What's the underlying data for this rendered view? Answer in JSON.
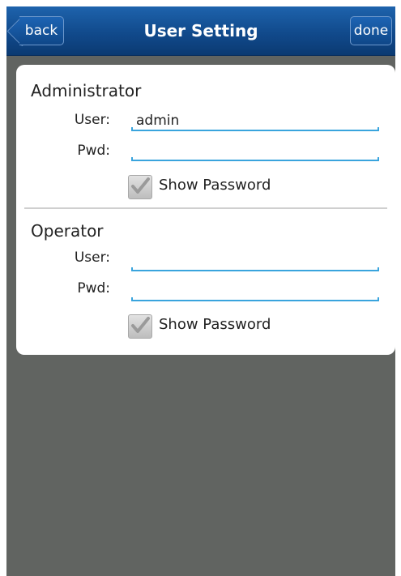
{
  "header": {
    "title": "User Setting",
    "back_label": "back",
    "done_label": "done"
  },
  "administrator": {
    "title": "Administrator",
    "user_label": "User:",
    "user_value": "admin",
    "pwd_label": "Pwd:",
    "pwd_value": "",
    "show_password_label": "Show Password",
    "show_password_checked": true
  },
  "operator": {
    "title": "Operator",
    "user_label": "User:",
    "user_value": "",
    "pwd_label": "Pwd:",
    "pwd_value": "",
    "show_password_label": "Show Password",
    "show_password_checked": true
  },
  "colors": {
    "titlebar": "#114a8c",
    "background": "#616461",
    "input_underline": "#39a4dd"
  },
  "icons": {
    "back": "chevron-left-icon",
    "checkbox": "checkmark-icon"
  }
}
